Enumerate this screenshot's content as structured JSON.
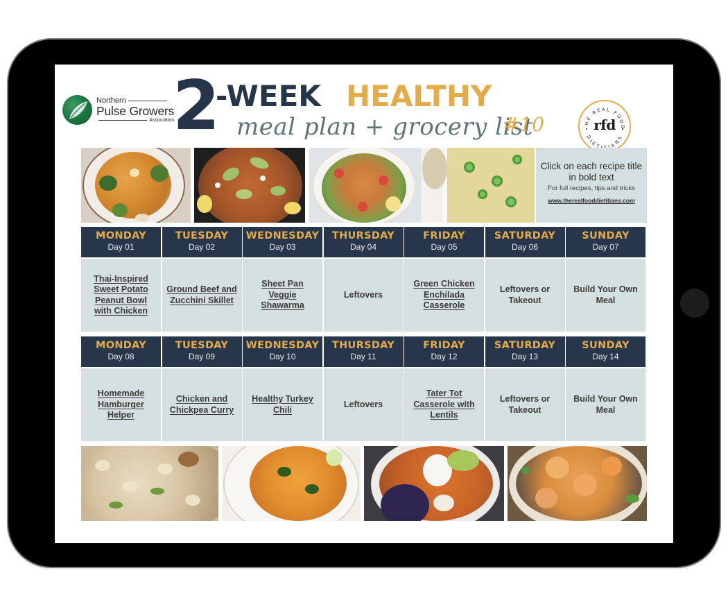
{
  "sponsor": {
    "line1": "Northern",
    "line2": "Pulse Growers",
    "line3": "Association"
  },
  "title": {
    "number": "2",
    "week": "-WEEK",
    "healthy": "HEALTHY",
    "subtitle": "meal plan + grocery list",
    "edition": "#10"
  },
  "brand": {
    "mark": "rfd",
    "ring_top": "THE REAL FOOD",
    "ring_bottom": "DIETITIANS"
  },
  "info": {
    "headline": "Click on each recipe title in bold text",
    "subtext": "For full recipes, tips and tricks",
    "link": "www.therealfooddietitians.com"
  },
  "photos_top": [
    {
      "name": "sweet-potato-peanut-bowl-photo"
    },
    {
      "name": "ground-beef-zucchini-skillet-photo"
    },
    {
      "name": "veggie-shawarma-photo"
    },
    {
      "name": "green-chicken-enchilada-photo"
    }
  ],
  "photos_bottom": [
    {
      "name": "hamburger-helper-photo"
    },
    {
      "name": "chickpea-curry-photo"
    },
    {
      "name": "turkey-chili-photo"
    },
    {
      "name": "tater-tot-casserole-photo"
    }
  ],
  "weeks": [
    {
      "days": [
        {
          "day": "MONDAY",
          "num": "Day 01",
          "meal": "Thai-Inspired Sweet Potato Peanut Bowl with Chicken",
          "link": true
        },
        {
          "day": "TUESDAY",
          "num": "Day 02",
          "meal": "Ground Beef and Zucchini Skillet",
          "link": true
        },
        {
          "day": "WEDNESDAY",
          "num": "Day 03",
          "meal": "Sheet Pan Veggie Shawarma",
          "link": true
        },
        {
          "day": "THURSDAY",
          "num": "Day 04",
          "meal": "Leftovers",
          "link": false
        },
        {
          "day": "FRIDAY",
          "num": "Day 05",
          "meal": "Green Chicken Enchilada Casserole",
          "link": true
        },
        {
          "day": "SATURDAY",
          "num": "Day 06",
          "meal": "Leftovers or Takeout",
          "link": false
        },
        {
          "day": "SUNDAY",
          "num": "Day 07",
          "meal": "Build Your Own Meal",
          "link": false
        }
      ]
    },
    {
      "days": [
        {
          "day": "MONDAY",
          "num": "Day 08",
          "meal": "Homemade Hamburger Helper",
          "link": true
        },
        {
          "day": "TUESDAY",
          "num": "Day 09",
          "meal": "Chicken and Chickpea Curry",
          "link": true
        },
        {
          "day": "WEDNESDAY",
          "num": "Day 10",
          "meal": "Healthy Turkey Chili",
          "link": true
        },
        {
          "day": "THURSDAY",
          "num": "Day 11",
          "meal": "Leftovers",
          "link": false
        },
        {
          "day": "FRIDAY",
          "num": "Day 12",
          "meal": "Tater Tot Casserole with Lentils",
          "link": true
        },
        {
          "day": "SATURDAY",
          "num": "Day 13",
          "meal": "Leftovers or Takeout",
          "link": false
        },
        {
          "day": "SUNDAY",
          "num": "Day 14",
          "meal": "Build Your Own Meal",
          "link": false
        }
      ]
    }
  ],
  "colors": {
    "navy": "#27364a",
    "gold": "#e4ab4a",
    "cell": "#d5dfe0",
    "script": "#5d7574"
  }
}
